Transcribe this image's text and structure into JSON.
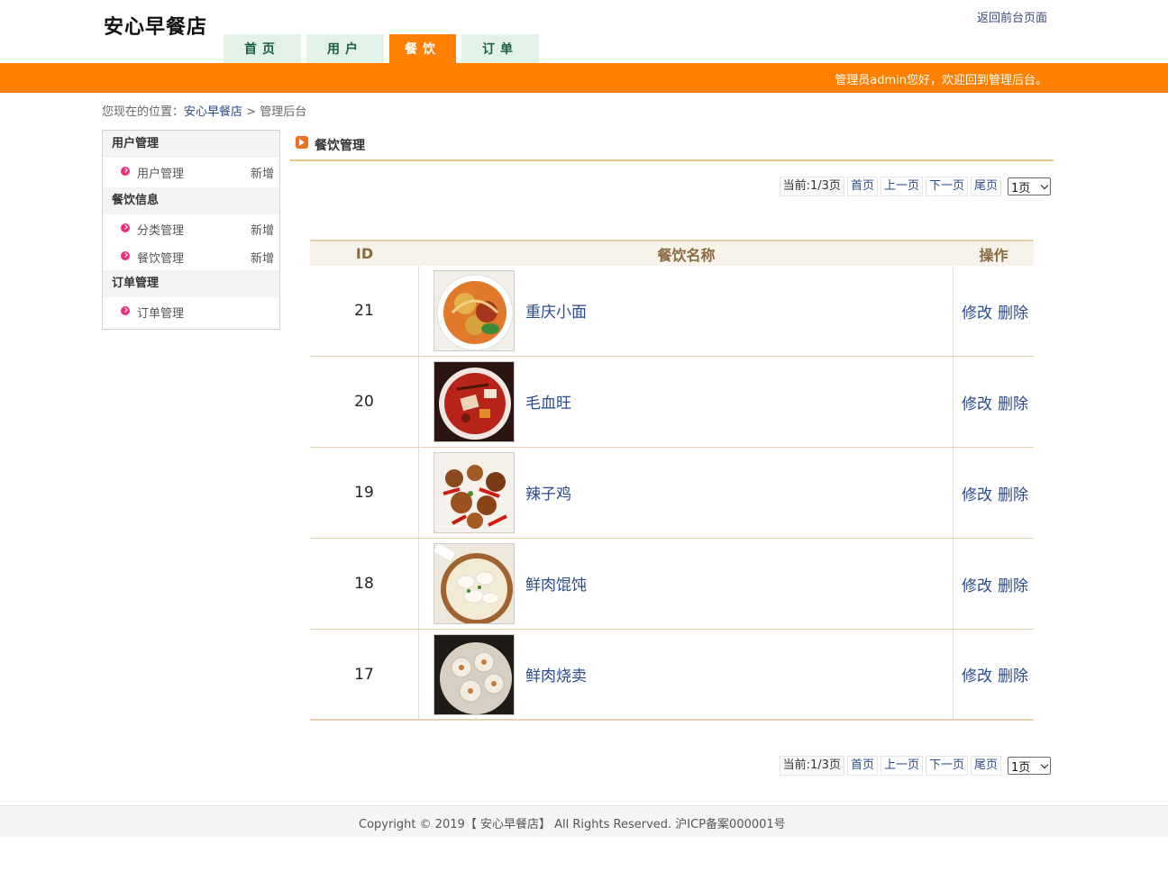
{
  "header": {
    "logo": "安心早餐店",
    "back_link": "返回前台页面",
    "tabs": [
      {
        "label": "首页",
        "active": false
      },
      {
        "label": "用户",
        "active": false
      },
      {
        "label": "餐饮",
        "active": true
      },
      {
        "label": "订单",
        "active": false
      }
    ],
    "welcome": "管理员admin您好，欢迎回到管理后台。",
    "accent_color": "#ff8000"
  },
  "breadcrumb": {
    "prefix": "您现在的位置：",
    "home": "安心早餐店",
    "separator": ">",
    "current": "管理后台"
  },
  "sidebar": {
    "groups": [
      {
        "title": "用户管理",
        "items": [
          {
            "label": "用户管理",
            "add": "新增"
          }
        ]
      },
      {
        "title": "餐饮信息",
        "items": [
          {
            "label": "分类管理",
            "add": "新增"
          },
          {
            "label": "餐饮管理",
            "add": "新增"
          }
        ]
      },
      {
        "title": "订单管理",
        "items": [
          {
            "label": "订单管理"
          }
        ]
      }
    ]
  },
  "content": {
    "title": "餐饮管理",
    "pager": {
      "current": "当前:1/3页",
      "first": "首页",
      "prev": "上一页",
      "next": "下一页",
      "last": "尾页",
      "select_value": "1页"
    },
    "table": {
      "headers": [
        "ID",
        "餐饮名称",
        "操作"
      ],
      "rows": [
        {
          "id": "21",
          "name": "重庆小面",
          "image": "chongqing-noodles-photo"
        },
        {
          "id": "20",
          "name": "毛血旺",
          "image": "maoxuewang-photo"
        },
        {
          "id": "19",
          "name": "辣子鸡",
          "image": "spicy-chicken-photo"
        },
        {
          "id": "18",
          "name": "鲜肉馄饨",
          "image": "wonton-soup-photo"
        },
        {
          "id": "17",
          "name": "鲜肉烧卖",
          "image": "shumai-photo"
        }
      ],
      "edit_label": "修改",
      "delete_label": "删除"
    }
  },
  "footer": {
    "text": "Copyright © 2019【 安心早餐店】 All Rights Reserved. 沪ICP备案000001号"
  }
}
